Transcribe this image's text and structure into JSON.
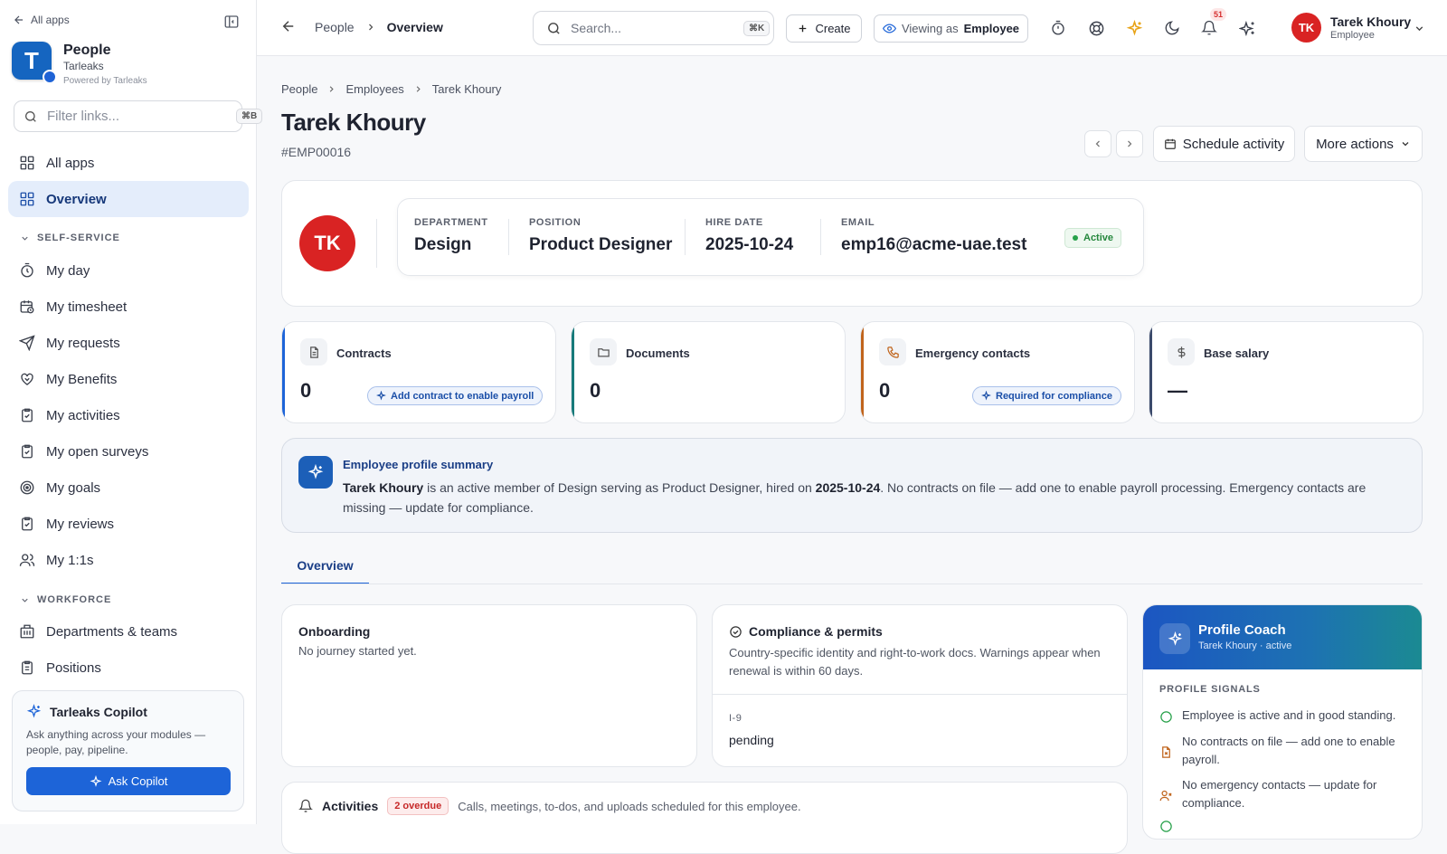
{
  "sidebar": {
    "all_apps_link": "All apps",
    "brand": {
      "logo_letter": "T",
      "title": "People",
      "subtitle": "Tarleaks",
      "powered": "Powered by Tarleaks"
    },
    "filter": {
      "placeholder": "Filter links...",
      "shortcut": "⌘B"
    },
    "items": [
      {
        "label": "All apps",
        "icon": "grid-icon"
      },
      {
        "label": "Overview",
        "icon": "grid-icon",
        "active": true
      }
    ],
    "sections": [
      {
        "label": "SELF-SERVICE",
        "items": [
          {
            "label": "My day",
            "icon": "stopwatch-icon"
          },
          {
            "label": "My timesheet",
            "icon": "calendar-clock-icon"
          },
          {
            "label": "My requests",
            "icon": "send-icon"
          },
          {
            "label": "My Benefits",
            "icon": "heart-hand-icon"
          },
          {
            "label": "My activities",
            "icon": "clipboard-check-icon"
          },
          {
            "label": "My open surveys",
            "icon": "clipboard-check-icon"
          },
          {
            "label": "My goals",
            "icon": "target-icon"
          },
          {
            "label": "My reviews",
            "icon": "clipboard-check-icon"
          },
          {
            "label": "My 1:1s",
            "icon": "users-icon"
          }
        ]
      },
      {
        "label": "WORKFORCE",
        "items": [
          {
            "label": "Departments & teams",
            "icon": "building-icon"
          },
          {
            "label": "Positions",
            "icon": "clipboard-icon"
          }
        ]
      }
    ],
    "copilot": {
      "title": "Tarleaks Copilot",
      "description": "Ask anything across your modules — people, pay, pipeline.",
      "button": "Ask Copilot"
    }
  },
  "topbar": {
    "breadcrumb": [
      "People",
      "Overview"
    ],
    "search": {
      "placeholder": "Search...",
      "shortcut": "⌘K"
    },
    "create_label": "Create",
    "viewing_prefix": "Viewing as",
    "viewing_role": "Employee",
    "notifications_count": "51",
    "user": {
      "initials": "TK",
      "name": "Tarek Khoury",
      "role": "Employee"
    }
  },
  "page": {
    "breadcrumb": [
      "People",
      "Employees",
      "Tarek Khoury"
    ],
    "title": "Tarek Khoury",
    "employee_id": "#EMP00016",
    "schedule_label": "Schedule activity",
    "more_label": "More actions"
  },
  "profile": {
    "initials": "TK",
    "fields": [
      {
        "label": "DEPARTMENT",
        "value": "Design"
      },
      {
        "label": "POSITION",
        "value": "Product Designer"
      },
      {
        "label": "HIRE DATE",
        "value": "2025-10-24"
      },
      {
        "label": "EMAIL",
        "value": "emp16@acme-uae.test"
      }
    ],
    "status": "Active"
  },
  "stats": [
    {
      "title": "Contracts",
      "value": "0",
      "pill": "Add contract to enable payroll",
      "icon": "document-icon",
      "accent": "#1d64d8"
    },
    {
      "title": "Documents",
      "value": "0",
      "pill": "",
      "icon": "folder-icon",
      "accent": "#177a7a"
    },
    {
      "title": "Emergency contacts",
      "value": "0",
      "pill": "Required for compliance",
      "icon": "phone-icon",
      "accent": "#c0641c"
    },
    {
      "title": "Base salary",
      "value": "—",
      "pill": "",
      "icon": "dollar-icon",
      "accent": "#3b4a6b"
    }
  ],
  "summary": {
    "title": "Employee profile summary",
    "name": "Tarek Khoury",
    "text_1": " is an active member of Design serving as Product Designer, hired on ",
    "date": "2025-10-24",
    "text_2": ". No contracts on file — add one to enable payroll processing. Emergency contacts are missing — update for compliance."
  },
  "tabs": [
    {
      "label": "Overview",
      "active": true
    }
  ],
  "onboarding": {
    "title": "Onboarding",
    "subtitle": "No journey started yet."
  },
  "compliance": {
    "title": "Compliance & permits",
    "subtitle": "Country-specific identity and right-to-work docs. Warnings appear when renewal is within 60 days.",
    "doc_label": "I-9",
    "doc_status": "pending"
  },
  "activities": {
    "title": "Activities",
    "overdue": "2 overdue",
    "subtitle": "Calls, meetings, to-dos, and uploads scheduled for this employee."
  },
  "coach": {
    "title": "Profile Coach",
    "subtitle": "Tarek Khoury · active",
    "signals_label": "PROFILE SIGNALS",
    "signals": [
      {
        "text": "Employee is active and in good standing.",
        "color": "#27a14a"
      },
      {
        "text": "No contracts on file — add one to enable payroll.",
        "color": "#c0641c"
      },
      {
        "text": "No emergency contacts — update for compliance.",
        "color": "#c0641c"
      }
    ]
  },
  "colors": {
    "primary": "#1d64d8",
    "danger": "#d92323",
    "success": "#27a14a"
  }
}
